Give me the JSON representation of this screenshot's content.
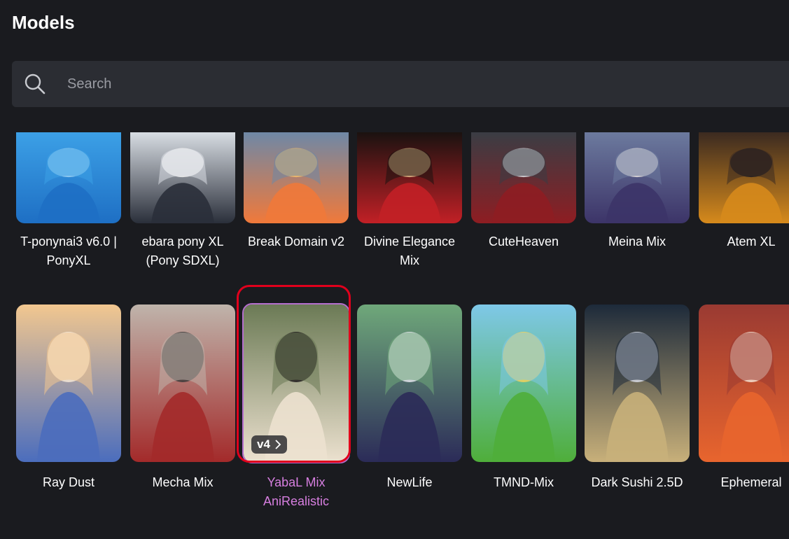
{
  "page": {
    "title": "Models"
  },
  "search": {
    "placeholder": "Search",
    "icon": "search-icon"
  },
  "models_row1": [
    {
      "name": "T-ponynai3 v6.0 |\nPonyXL",
      "colors": [
        "#3ca0e6",
        "#1e6fc4",
        "#9fd4f5"
      ]
    },
    {
      "name": "ebara pony XL\n(Pony SDXL)",
      "colors": [
        "#d8dde3",
        "#2a2f3a",
        "#f2f2f2"
      ]
    },
    {
      "name": "Break Domain v2",
      "colors": [
        "#6e88a6",
        "#f0793a",
        "#f7c06b"
      ]
    },
    {
      "name": "Divine Elegance\nMix",
      "colors": [
        "#1a1210",
        "#c22026",
        "#e8c08c"
      ]
    },
    {
      "name": "CuteHeaven",
      "colors": [
        "#3a3d44",
        "#8e1d22",
        "#dfe3e8"
      ]
    },
    {
      "name": "Meina Mix",
      "colors": [
        "#6c7a9e",
        "#3c3468",
        "#eae4e0"
      ]
    },
    {
      "name": "Atem XL",
      "colors": [
        "#3b2a20",
        "#d68a1c",
        "#1f1b22"
      ]
    }
  ],
  "models_row2": [
    {
      "name": "Ray Dust",
      "selected": false,
      "colors": [
        "#f2c78f",
        "#4b6dbd",
        "#f6e9d7"
      ]
    },
    {
      "name": "Mecha Mix",
      "selected": false,
      "colors": [
        "#bfb4ab",
        "#a32a2a",
        "#3c3a3a"
      ]
    },
    {
      "name": "YabaL Mix\nAniRealistic",
      "selected": true,
      "badge": "v4",
      "colors": [
        "#6b7a55",
        "#ece1cf",
        "#1e1a1c"
      ]
    },
    {
      "name": "NewLife",
      "selected": false,
      "colors": [
        "#6fa87a",
        "#2b2b58",
        "#e6e6ef"
      ]
    },
    {
      "name": "TMND-Mix",
      "selected": false,
      "colors": [
        "#7ec8e8",
        "#4fae3a",
        "#f5d25a"
      ]
    },
    {
      "name": "Dark Sushi 2.5D",
      "selected": false,
      "colors": [
        "#1d2a3a",
        "#c8b07a",
        "#d8dce6"
      ]
    },
    {
      "name": "Ephemeral",
      "selected": false,
      "colors": [
        "#9a3a32",
        "#e8652e",
        "#f4e3d4"
      ]
    }
  ],
  "theme": {
    "accent_selected": "#d77fe0",
    "highlight_ring": "#e0001c",
    "background": "#1a1b1f",
    "search_bg": "#2b2d33"
  }
}
